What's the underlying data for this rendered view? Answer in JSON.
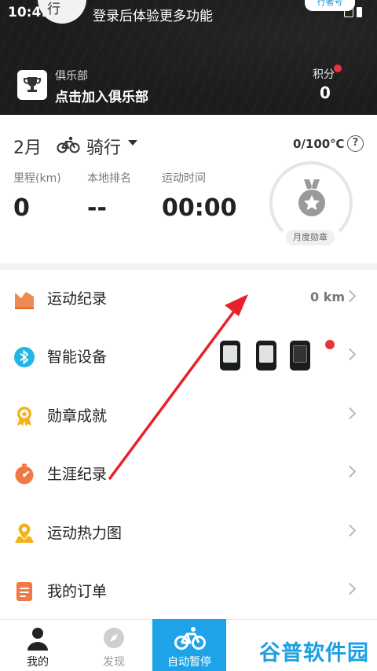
{
  "status_bar": {
    "time": "10:41"
  },
  "header": {
    "avatar_text": "行",
    "login_hint": "登录后体验更多功能",
    "ride_badge": "行者号",
    "club_label": "俱乐部",
    "club_join": "点击加入俱乐部",
    "points_label": "积分",
    "points_value": "0"
  },
  "stats": {
    "month": "2月",
    "sport": "骑行",
    "goal": "0/100℃",
    "distance_label": "里程(km)",
    "distance_value": "0",
    "rank_label": "本地排名",
    "rank_value": "--",
    "time_label": "运动时间",
    "time_value": "00:00",
    "medal_label": "月度勋章"
  },
  "menu": [
    {
      "label": "运动纪录",
      "value": "0 km",
      "icon": "chart-icon"
    },
    {
      "label": "智能设备",
      "icon": "bluetooth-icon"
    },
    {
      "label": "勋章成就",
      "icon": "medal-icon"
    },
    {
      "label": "生涯纪录",
      "icon": "stopwatch-icon"
    },
    {
      "label": "运动热力图",
      "icon": "map-pin-icon"
    },
    {
      "label": "我的订单",
      "icon": "order-icon"
    }
  ],
  "tabbar": {
    "tabs": [
      {
        "label": "我的",
        "icon": "person-icon"
      },
      {
        "label": "发现",
        "icon": "compass-icon"
      },
      {
        "label": "自动暂停",
        "icon": "bike-icon"
      }
    ]
  },
  "watermark": "谷普软件园",
  "colors": {
    "accent": "#1fa3e8",
    "header_bg": "#1c1c1c",
    "annotation_arrow": "#e8202a"
  }
}
